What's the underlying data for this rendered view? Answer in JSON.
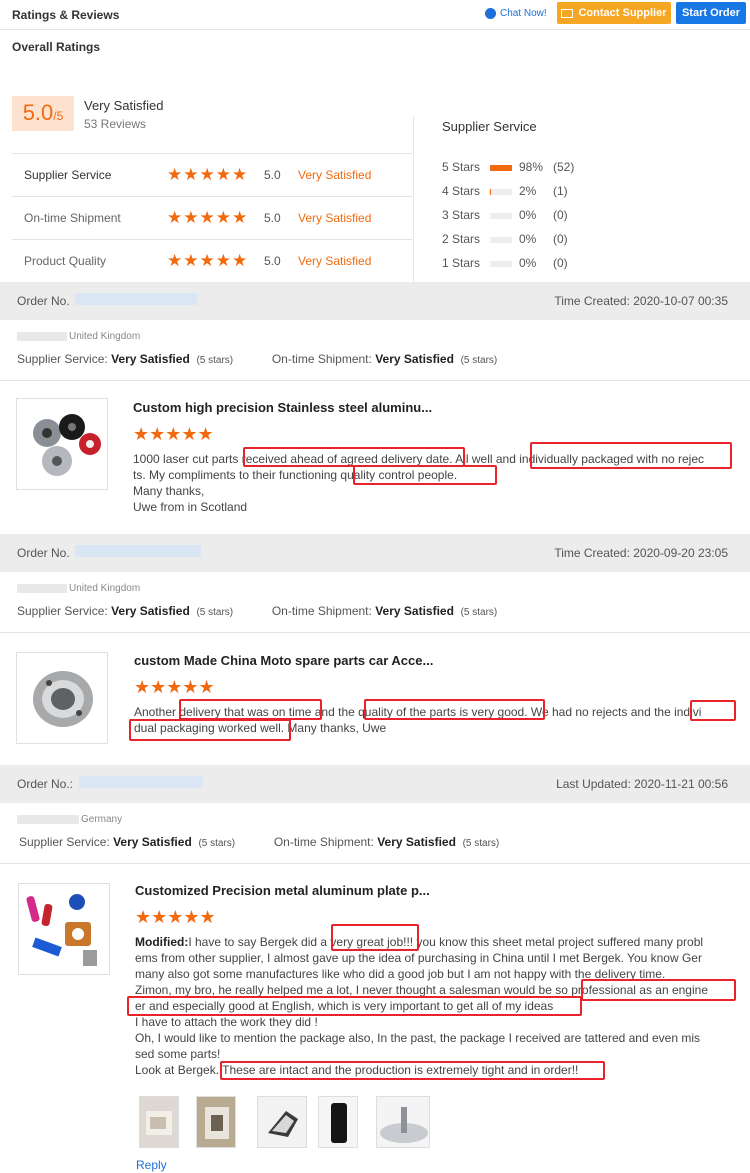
{
  "header": {
    "title": "Ratings & Reviews",
    "chat_label": "Chat Now!",
    "contact_label": "Contact Supplier",
    "start_order_label": "Start Order"
  },
  "overall": {
    "title": "Overall Ratings",
    "score": "5.0",
    "score_suffix": "/5",
    "label": "Very Satisfied",
    "reviews": "53 Reviews",
    "categories": [
      {
        "label": "Supplier Service",
        "stars": 5,
        "value": "5.0",
        "text": "Very Satisfied"
      },
      {
        "label": "On-time Shipment",
        "stars": 5,
        "value": "5.0",
        "text": "Very Satisfied"
      },
      {
        "label": "Product Quality",
        "stars": 5,
        "value": "5.0",
        "text": "Very Satisfied"
      }
    ]
  },
  "distribution": {
    "title": "Supplier Service",
    "rows": [
      {
        "label": "5 Stars",
        "percent": "98%",
        "count": "(52)",
        "fill": 0.98
      },
      {
        "label": "4 Stars",
        "percent": "2%",
        "count": "(1)",
        "fill": 0.02
      },
      {
        "label": "3 Stars",
        "percent": "0%",
        "count": "(0)",
        "fill": 0
      },
      {
        "label": "2 Stars",
        "percent": "0%",
        "count": "(0)",
        "fill": 0
      },
      {
        "label": "1 Stars",
        "percent": "0%",
        "count": "(0)",
        "fill": 0
      }
    ]
  },
  "reviews": [
    {
      "order_label": "Order No.",
      "time": "Time Created: 2020-10-07 00:35",
      "country": "United Kingdom",
      "supplier_label": "Supplier Service:",
      "supplier_value": "Very Satisfied",
      "supplier_stars": "(5 stars)",
      "shipment_label": "On-time Shipment:",
      "shipment_value": "Very Satisfied",
      "shipment_stars": "(5 stars)",
      "product_title": "Custom high precision Stainless steel aluminu...",
      "text_lines": [
        "1000 laser cut parts received ahead of agreed delivery date. All well and individually packaged with no rejec",
        "ts.  My compliments to their functioning quality control people.",
        "Many thanks,",
        "Uwe from in Scotland"
      ]
    },
    {
      "order_label": "Order No.",
      "time": "Time Created: 2020-09-20 23:05",
      "country": "United Kingdom",
      "supplier_label": "Supplier Service:",
      "supplier_value": "Very Satisfied",
      "supplier_stars": "(5 stars)",
      "shipment_label": "On-time Shipment:",
      "shipment_value": "Very Satisfied",
      "shipment_stars": "(5 stars)",
      "product_title": "custom Made China Moto spare parts car Acce...",
      "text_lines": [
        "Another delivery that was on time and the quality of the parts is very good. We had no rejects and the indivi",
        "dual packaging worked well. Many thanks, Uwe"
      ]
    },
    {
      "order_label": "Order No.:",
      "time": "Last Updated: 2020-11-21 00:56",
      "country": "Germany",
      "supplier_label": "Supplier Service:",
      "supplier_value": "Very Satisfied",
      "supplier_stars": "(5 stars)",
      "shipment_label": "On-time Shipment:",
      "shipment_value": "Very Satisfied",
      "shipment_stars": "(5 stars)",
      "product_title": "Customized Precision metal aluminum plate p...",
      "modified_label": "Modified:",
      "text_lines": [
        "I have to say Bergek did a very great job!!! you know this sheet metal project suffered many probl",
        "ems from other supplier, I almost gave up the idea of purchasing in China until I met Bergek.  You know Ger",
        "many also got some manufactures like who did a good job but I am not happy with the delivery time.",
        "Zimon, my bro, he really helped me a lot, I never thought a salesman would be so professional as an engine",
        "er and especially good at English, which is very important to get all of my ideas",
        "I have to attach the work they did !",
        "Oh, I would like to mention the package also,  In the past,  the package I received are tattered and even mis",
        "sed some parts!",
        "Look at Bergek.  These are intact and the production is extremely tight and in order!!"
      ],
      "reply_label": "Reply"
    }
  ],
  "star_glyphs": "★★★★★",
  "colors": {
    "accent": "#f26a10",
    "link": "#1e6fd9",
    "highlight": "#e8232a"
  }
}
